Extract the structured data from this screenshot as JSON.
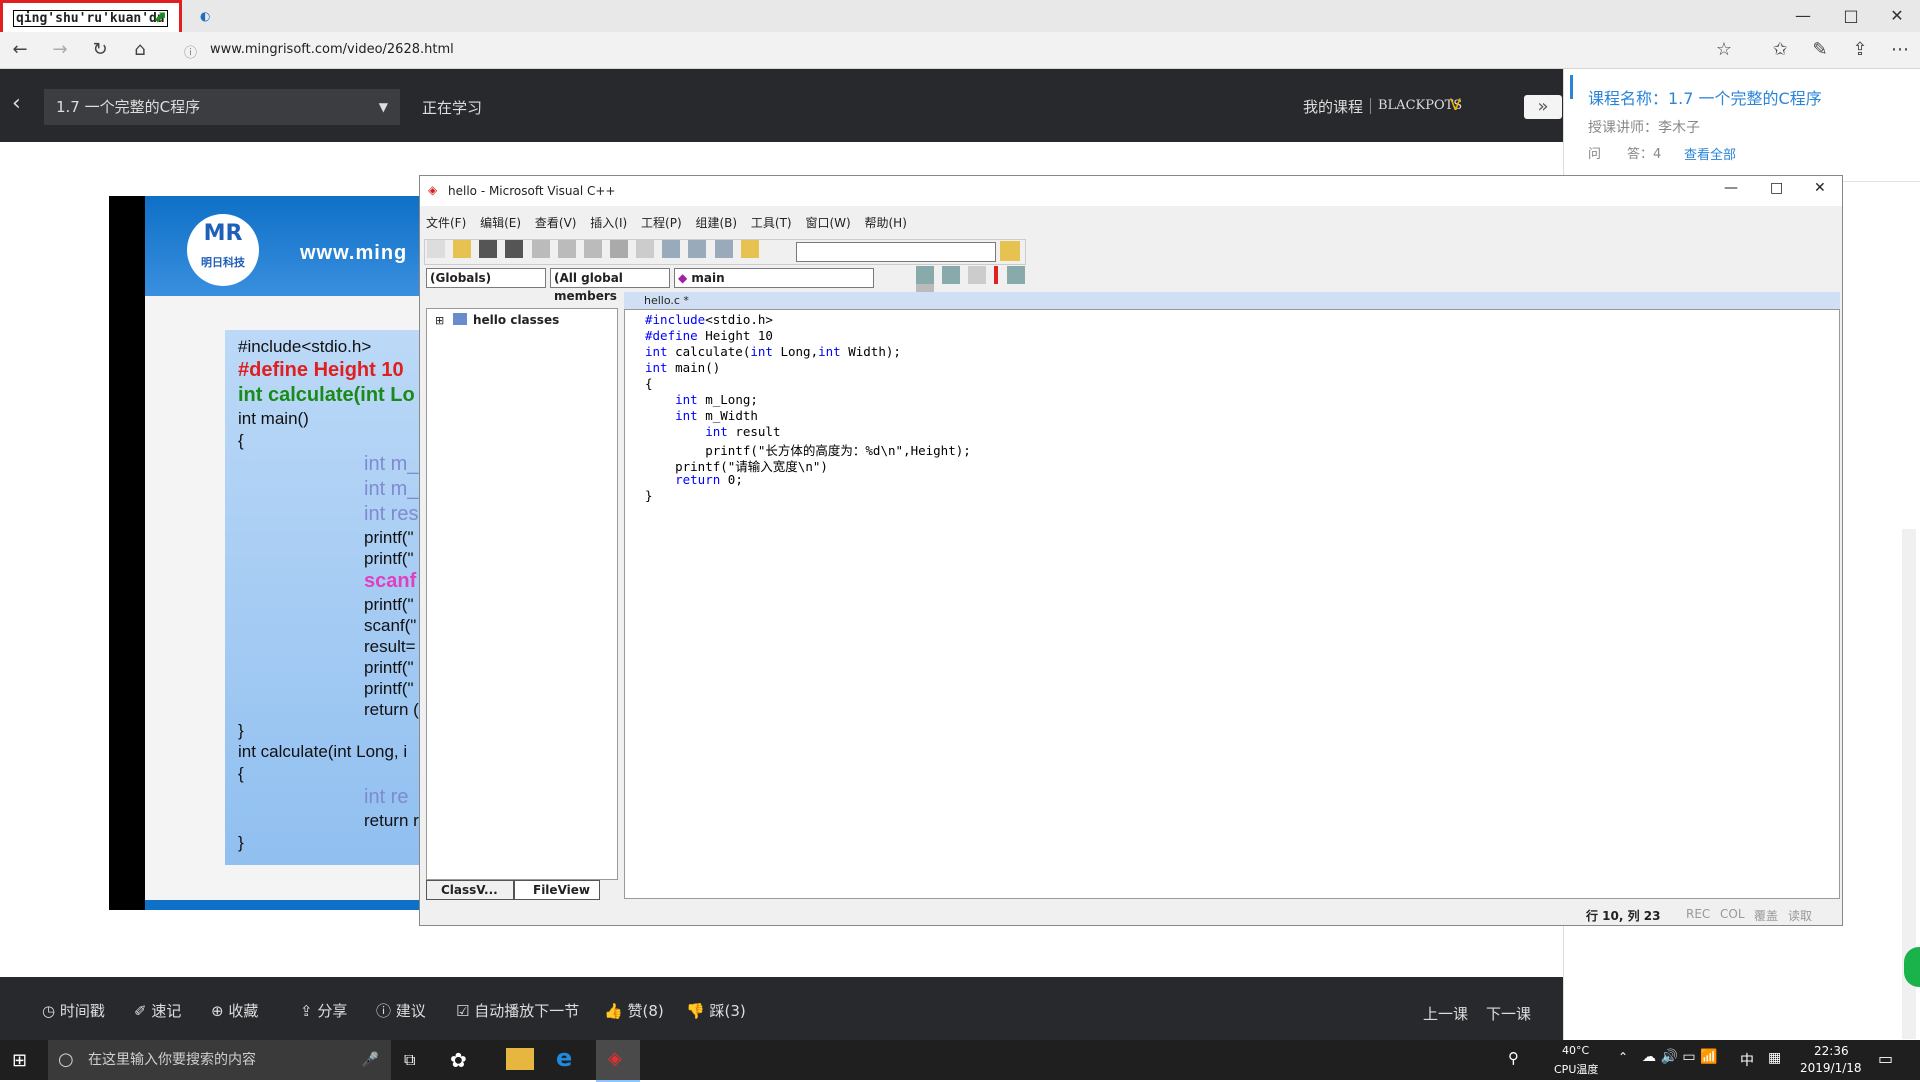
{
  "ime": {
    "text": "qing'shu'ru'kuan'du"
  },
  "browser": {
    "url": "www.mingrisoft.com/video/2628.html",
    "window_controls": [
      "—",
      "□",
      "✕"
    ]
  },
  "course_page": {
    "lesson_select": "1.7 一个完整的C程序",
    "status": "正在学习",
    "my_courses": "我的课程",
    "user": "BLACKPOTS",
    "expand_icon": "»",
    "right_panel": {
      "course_name": "课程名称：1.7 一个完整的C程序",
      "teacher": "授课讲师：李木子",
      "qa": "问　　答：4",
      "view_all": "查看全部"
    },
    "bottom_bar": {
      "items": [
        "时间戳",
        "速记",
        "收藏",
        "分享",
        "建议",
        "自动播放下一节",
        "赞(8)",
        "踩(3)"
      ],
      "prev": "上一课",
      "next": "下一课"
    }
  },
  "slide": {
    "site": "www.ming",
    "logo_text": "明日科技",
    "lines": [
      "#include<stdio.h>",
      "#define Height 10",
      "int calculate(int Lo",
      "int main()",
      "{",
      "int m_",
      "int m_",
      "int res",
      "printf(\"",
      "printf(\"",
      "scanf",
      "printf(\"",
      "scanf(\"",
      "result=",
      "printf(\"",
      "printf(\"",
      "return (",
      "}",
      " int calculate(int Long, i",
      " {",
      "int re",
      "return r",
      "}"
    ]
  },
  "vc": {
    "title": "hello - Microsoft Visual C++",
    "menu": [
      "文件(F)",
      "编辑(E)",
      "查看(V)",
      "插入(I)",
      "工程(P)",
      "组建(B)",
      "工具(T)",
      "窗口(W)",
      "帮助(H)"
    ],
    "combo_globals": "(Globals)",
    "combo_members": "(All global members",
    "combo_main": "main",
    "tree_root": "hello classes",
    "tabs": [
      "ClassV...",
      "FileView"
    ],
    "file_tab": "hello.c *",
    "code": [
      "#include<stdio.h>",
      "#define Height 10",
      "int calculate(int Long,int Width);",
      "int main()",
      "{",
      "    int m_Long;",
      "    int m_Width",
      "        int result",
      "        printf(\"长方体的高度为：%d\\n\",Height);",
      "    printf(\"请输入宽度\\n\")",
      "    return 0;",
      "}"
    ],
    "status": [
      "行 10, 列 23",
      "REC",
      "COL",
      "覆盖",
      "读取"
    ]
  },
  "taskbar": {
    "search_placeholder": "在这里输入你要搜索的内容",
    "temp": "40°C",
    "temp_label": "CPU温度",
    "ime_lang": "中",
    "time": "22:36",
    "date": "2019/1/18"
  }
}
